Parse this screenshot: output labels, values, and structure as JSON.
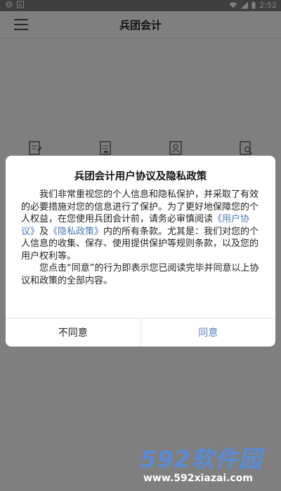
{
  "status_bar": {
    "time": "2:52",
    "left_icons": [
      "settings-icon",
      "text-a-icon"
    ],
    "right_icons": [
      "wifi-icon",
      "signal-icon",
      "battery-icon"
    ]
  },
  "app_bar": {
    "title": "兵团会计",
    "menu_icon": "menu-icon"
  },
  "features": {
    "icons": [
      "document-edit-icon",
      "document-icon",
      "person-card-icon",
      "document-search-icon"
    ]
  },
  "dialog": {
    "title": "兵团会计用户协议及隐私政策",
    "para1_a": "我们非常重视您的个人信息和隐私保护，并采取了有效的必要措施对您的信息进行了保护。为了更好地保障您的个人权益，在您使用兵团会计前，请务必审慎阅读",
    "link_user_agreement": "《用户协议》",
    "para1_b": "及",
    "link_privacy_policy": "《隐私政策》",
    "para1_c": "内的所有条款。尤其是：我们对您的个人信息的收集、保存、使用提供保护等规则条款，以及您的用户权利等。",
    "para2": "您点击“同意”的行为即表示您已阅读完毕并同意以上协议和政策的全部内容。",
    "disagree_label": "不同意",
    "agree_label": "同意"
  },
  "watermark": {
    "brand": "592软件园",
    "url": "www.592xiazai.com"
  },
  "colors": {
    "link": "#4a79b4",
    "agree": "#5a7fb8",
    "overlay": "rgba(0,0,0,0.5)",
    "watermark_brand": "#5a8cd6"
  }
}
